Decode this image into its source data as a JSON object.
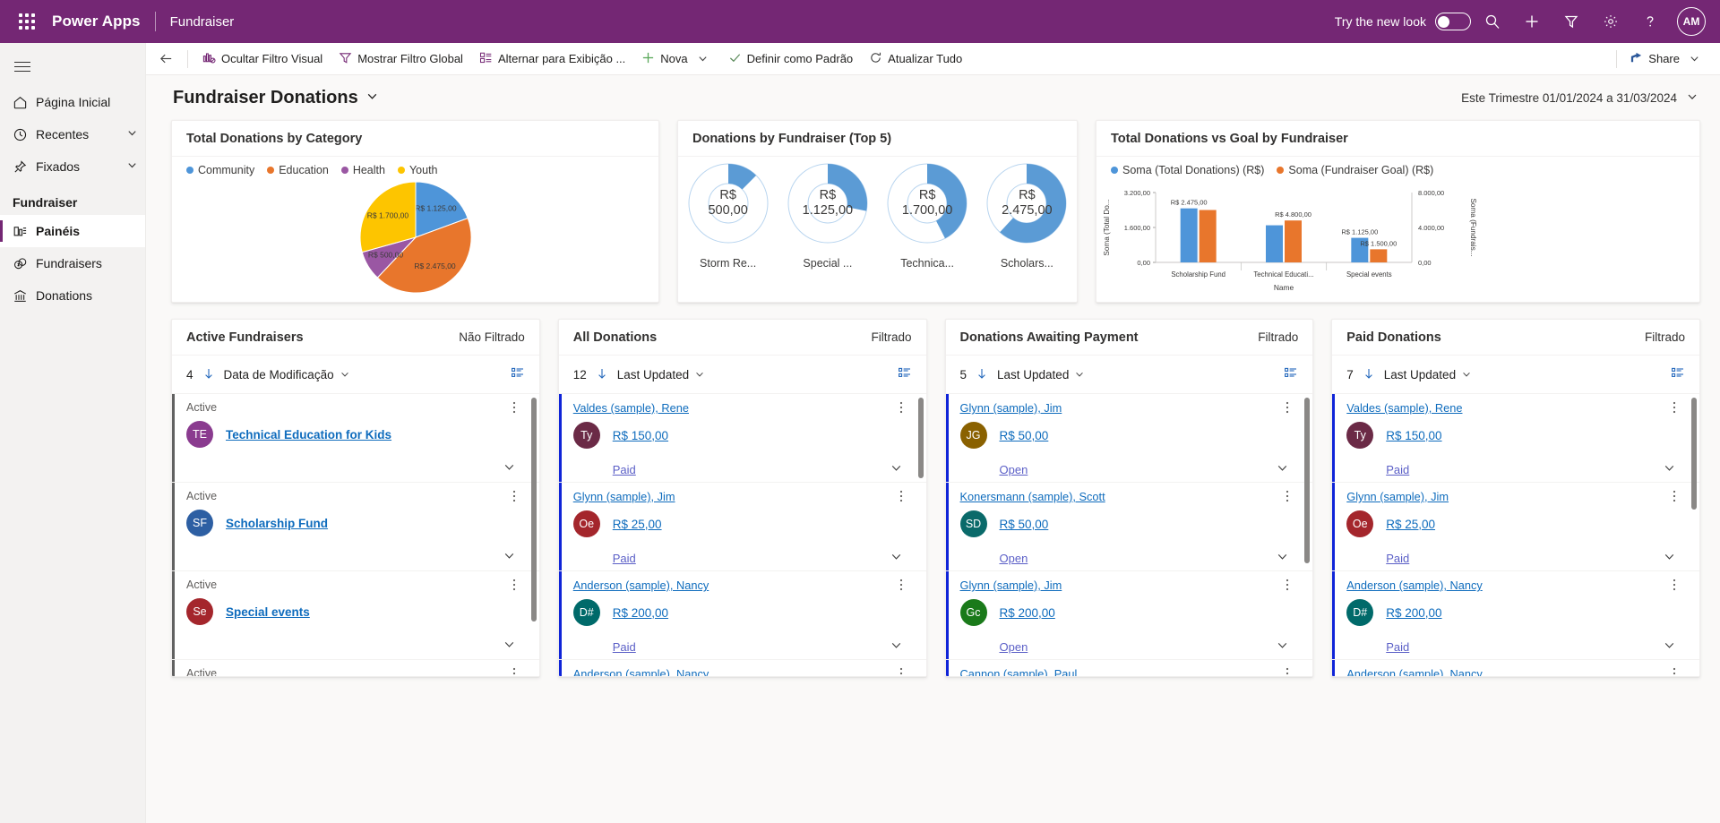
{
  "header": {
    "brand": "Power Apps",
    "app_name": "Fundraiser",
    "try_new_look": "Try the new look",
    "icons": [
      "search-icon",
      "add-icon",
      "filter-icon",
      "gear-icon",
      "help-icon"
    ],
    "avatar_initials": "AM"
  },
  "sidebar": {
    "items": [
      {
        "label": "Página Inicial",
        "icon": "home-icon",
        "chevron": false,
        "selected": false
      },
      {
        "label": "Recentes",
        "icon": "clock-icon",
        "chevron": true,
        "selected": false
      },
      {
        "label": "Fixados",
        "icon": "pin-icon",
        "chevron": true,
        "selected": false
      }
    ],
    "group_title": "Fundraiser",
    "group_items": [
      {
        "label": "Painéis",
        "icon": "dashboard-icon",
        "selected": true
      },
      {
        "label": "Fundraisers",
        "icon": "money-icon",
        "selected": false
      },
      {
        "label": "Donations",
        "icon": "bank-icon",
        "selected": false
      }
    ]
  },
  "commandbar": {
    "back": "back-arrow-icon",
    "buttons": [
      {
        "label": "Ocultar Filtro Visual",
        "icon": "chart-hide-icon",
        "caret": false
      },
      {
        "label": "Mostrar Filtro Global",
        "icon": "funnel-icon",
        "caret": false
      },
      {
        "label": "Alternar para Exibição ...",
        "icon": "layout-icon",
        "caret": false
      },
      {
        "label": "Nova",
        "icon": "plus-icon",
        "caret": true
      },
      {
        "label": "Definir como Padrão",
        "icon": "check-icon",
        "caret": false
      },
      {
        "label": "Atualizar Tudo",
        "icon": "refresh-icon",
        "caret": false
      }
    ],
    "share": {
      "label": "Share",
      "icon": "share-icon",
      "caret": true
    }
  },
  "page": {
    "title": "Fundraiser Donations",
    "date_range": "Este Trimestre 01/01/2024 a 31/03/2024"
  },
  "chart_data": [
    {
      "type": "pie",
      "title": "Total Donations by Category",
      "categories": [
        "Community",
        "Education",
        "Health",
        "Youth"
      ],
      "values": [
        1125,
        2475,
        500,
        1700
      ],
      "labels": [
        "R$ 1.125,00",
        "R$ 2.475,00",
        "R$ 500,00",
        "R$ 1.700,00"
      ],
      "colors": [
        "#4e95d9",
        "#e8762c",
        "#9a57a3",
        "#fdc500"
      ],
      "legend_position": "top"
    },
    {
      "type": "pie",
      "title": "Donations by Fundraiser (Top 5)",
      "subtype": "donut-gauges",
      "categories": [
        "Storm Re...",
        "Special ...",
        "Technica...",
        "Scholars..."
      ],
      "values": [
        500,
        1125,
        1700,
        2475
      ],
      "labels": [
        "R$ 500,00",
        "R$ 1.125,00",
        "R$ 1.700,00",
        "R$ 2.475,00"
      ],
      "max": 4000,
      "colors": [
        "#5b9bd5"
      ]
    },
    {
      "type": "bar",
      "title": "Total Donations vs Goal by Fundraiser",
      "categories": [
        "Scholarship Fund",
        "Technical Educati...",
        "Special events"
      ],
      "series": [
        {
          "name": "Soma (Total Donations) (R$)",
          "values": [
            2475,
            1700,
            1125
          ],
          "labels": [
            "R$ 2.475,00",
            "",
            "R$ 1.125,00"
          ],
          "color": "#4e95d9"
        },
        {
          "name": "Soma (Fundraiser Goal) (R$)",
          "values": [
            6000,
            4800,
            1500
          ],
          "labels": [
            "",
            "R$ 4.800,00",
            "R$ 1.500,00"
          ],
          "color": "#e8762c"
        }
      ],
      "xlabel": "Name",
      "ylabel": "Soma (Total Do...",
      "y2label": "Soma (Fundrais...",
      "yticks": [
        "0,00",
        "1.600,00",
        "3.200,00"
      ],
      "y2ticks": [
        "0,00",
        "4.000,00",
        "8.000,00"
      ],
      "ylim": [
        0,
        3200
      ],
      "y2lim": [
        0,
        8000
      ],
      "grid": false,
      "legend_position": "top"
    }
  ],
  "panels": [
    {
      "title": "Active Fundraisers",
      "filter_status": "Não Filtrado",
      "count": "4",
      "sort": "Data de Modificação",
      "accent": "#616161",
      "rows": [
        {
          "head": "Active",
          "head_link": false,
          "avatar": "TE",
          "avatar_color": "#8a3b8f",
          "title": "Technical Education for Kids",
          "amount": "",
          "status": ""
        },
        {
          "head": "Active",
          "head_link": false,
          "avatar": "SF",
          "avatar_color": "#2d5fa3",
          "title": "Scholarship Fund",
          "amount": "",
          "status": ""
        },
        {
          "head": "Active",
          "head_link": false,
          "avatar": "Se",
          "avatar_color": "#a4262c",
          "title": "Special events",
          "amount": "",
          "status": ""
        },
        {
          "head": "Active",
          "head_link": false,
          "avatar": "",
          "avatar_color": "#0b6a0b",
          "title": "",
          "amount": "",
          "status": ""
        }
      ]
    },
    {
      "title": "All Donations",
      "filter_status": "Filtrado",
      "count": "12",
      "sort": "Last Updated",
      "accent": "#0f24d8",
      "rows": [
        {
          "head": "Valdes (sample), Rene",
          "head_link": true,
          "avatar": "Ty",
          "avatar_color": "#6b2a46",
          "title": "",
          "amount": "R$ 150,00",
          "status": "Paid"
        },
        {
          "head": "Glynn (sample), Jim",
          "head_link": true,
          "avatar": "Oe",
          "avatar_color": "#a4262c",
          "title": "",
          "amount": "R$ 25,00",
          "status": "Paid"
        },
        {
          "head": "Anderson (sample), Nancy",
          "head_link": true,
          "avatar": "D#",
          "avatar_color": "#006a6a",
          "title": "",
          "amount": "R$ 200,00",
          "status": "Paid"
        },
        {
          "head": "Anderson (sample), Nancy",
          "head_link": true,
          "avatar": "",
          "avatar_color": "#0b6a0b",
          "title": "",
          "amount": "",
          "status": ""
        }
      ]
    },
    {
      "title": "Donations Awaiting Payment",
      "filter_status": "Filtrado",
      "count": "5",
      "sort": "Last Updated",
      "accent": "#0f24d8",
      "rows": [
        {
          "head": "Glynn (sample), Jim",
          "head_link": true,
          "avatar": "JG",
          "avatar_color": "#8a6100",
          "title": "",
          "amount": "R$ 50,00",
          "status": "Open"
        },
        {
          "head": "Konersmann (sample), Scott",
          "head_link": true,
          "avatar": "SD",
          "avatar_color": "#0a6a6a",
          "title": "",
          "amount": "R$ 50,00",
          "status": "Open"
        },
        {
          "head": "Glynn (sample), Jim",
          "head_link": true,
          "avatar": "Gc",
          "avatar_color": "#1a7a1a",
          "title": "",
          "amount": "R$ 200,00",
          "status": "Open"
        },
        {
          "head": "Cannon (sample), Paul",
          "head_link": true,
          "avatar": "",
          "avatar_color": "#0b6a0b",
          "title": "",
          "amount": "",
          "status": ""
        }
      ]
    },
    {
      "title": "Paid Donations",
      "filter_status": "Filtrado",
      "count": "7",
      "sort": "Last Updated",
      "accent": "#0f24d8",
      "rows": [
        {
          "head": "Valdes (sample), Rene",
          "head_link": true,
          "avatar": "Ty",
          "avatar_color": "#6b2a46",
          "title": "",
          "amount": "R$ 150,00",
          "status": "Paid"
        },
        {
          "head": "Glynn (sample), Jim",
          "head_link": true,
          "avatar": "Oe",
          "avatar_color": "#a4262c",
          "title": "",
          "amount": "R$ 25,00",
          "status": "Paid"
        },
        {
          "head": "Anderson (sample), Nancy",
          "head_link": true,
          "avatar": "D#",
          "avatar_color": "#006a6a",
          "title": "",
          "amount": "R$ 200,00",
          "status": "Paid"
        },
        {
          "head": "Anderson (sample), Nancy",
          "head_link": true,
          "avatar": "",
          "avatar_color": "#0b6a0b",
          "title": "",
          "amount": "",
          "status": ""
        }
      ]
    }
  ]
}
